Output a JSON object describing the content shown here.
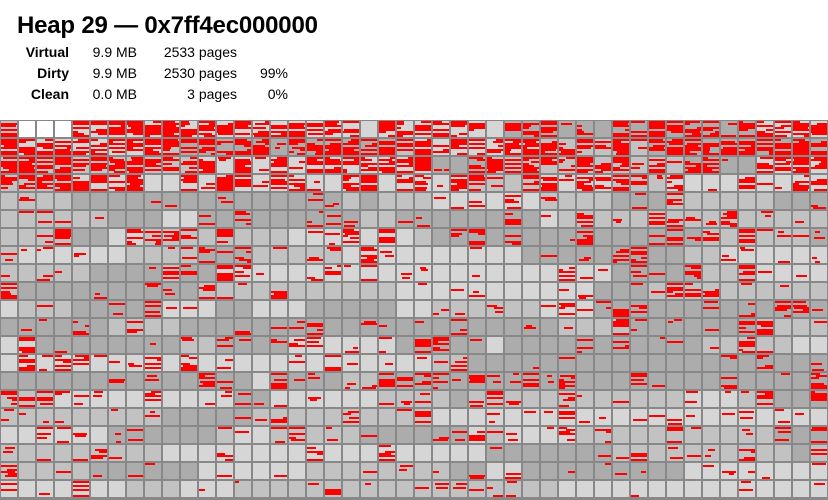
{
  "heap": {
    "title": "Heap 29 — 0x7ff4ec000000",
    "stats": [
      {
        "label": "Virtual",
        "size": "9.9 MB",
        "pages": "2533 pages",
        "percent": ""
      },
      {
        "label": "Dirty",
        "size": "9.9 MB",
        "pages": "2530 pages",
        "percent": "99%"
      },
      {
        "label": "Clean",
        "size": "0.0 MB",
        "pages": "3 pages",
        "percent": "0%"
      }
    ]
  },
  "page_map": {
    "columns": 46,
    "rows": 21,
    "colors": {
      "grid": "#888888",
      "dirty": "#ff0000",
      "clean": "#ffffff",
      "light": "#d6d6d6",
      "medium": "#c2c2c2",
      "dark": "#acacac"
    },
    "clean_cells": [
      1,
      2,
      3
    ],
    "row_red_density": [
      0.92,
      0.95,
      0.85,
      0.55,
      0.12,
      0.15,
      0.35,
      0.15,
      0.2,
      0.1,
      0.15,
      0.18,
      0.15,
      0.12,
      0.18,
      0.15,
      0.12,
      0.15,
      0.12,
      0.1,
      0.1
    ]
  }
}
